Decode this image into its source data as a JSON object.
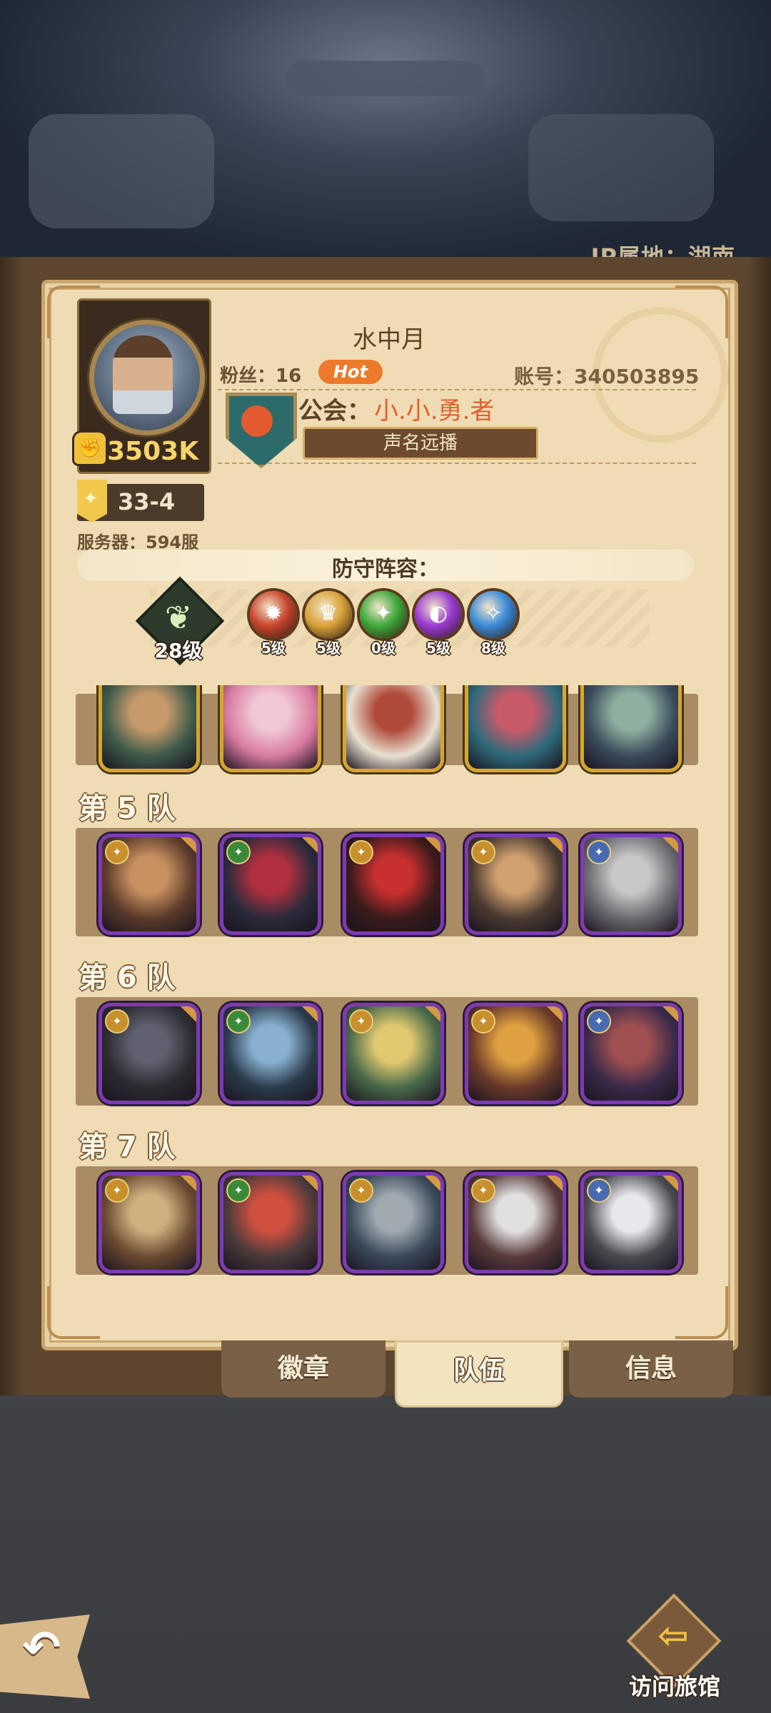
{
  "header": {
    "ip_location": "IP属地：湖南"
  },
  "profile": {
    "name": "水中月",
    "fans": "粉丝：16",
    "hot_badge": "Hot",
    "account": "账号：340503895",
    "power": "3503K",
    "stage": "33-4",
    "server": "服务器：594服",
    "guild_label": "公会：",
    "guild_name": "小.小.勇.者",
    "title": "声名远播"
  },
  "defense": {
    "title": "防守阵容：",
    "tree_level": "28级",
    "factions": [
      {
        "icon": "lightbearer-faction-icon",
        "level": "5级",
        "color": "#c8452c"
      },
      {
        "icon": "mauler-faction-icon",
        "level": "5级",
        "color": "#d9a23a"
      },
      {
        "icon": "wilder-faction-icon",
        "level": "0级",
        "color": "#3fa83a"
      },
      {
        "icon": "graveborn-faction-icon",
        "level": "5级",
        "color": "#9a3ad0"
      },
      {
        "icon": "celestial-faction-icon",
        "level": "8级",
        "color": "#3a8ad8"
      }
    ]
  },
  "teams": [
    {
      "label": "",
      "heroes": [
        "hero-portrait",
        "hero-portrait",
        "hero-portrait",
        "hero-portrait",
        "hero-portrait"
      ]
    },
    {
      "label": "第 5 队",
      "heroes": [
        "hero-portrait",
        "hero-portrait",
        "hero-portrait",
        "hero-portrait",
        "hero-portrait"
      ]
    },
    {
      "label": "第 6 队",
      "heroes": [
        "hero-portrait",
        "hero-portrait",
        "hero-portrait",
        "hero-portrait",
        "hero-portrait"
      ]
    },
    {
      "label": "第 7 队",
      "heroes": [
        "hero-portrait",
        "hero-portrait",
        "hero-portrait",
        "hero-portrait",
        "hero-portrait"
      ]
    }
  ],
  "tabs": [
    {
      "label": "徽章",
      "active": false
    },
    {
      "label": "队伍",
      "active": true
    },
    {
      "label": "信息",
      "active": false
    }
  ],
  "footer": {
    "visit_label": "访问旅馆"
  }
}
